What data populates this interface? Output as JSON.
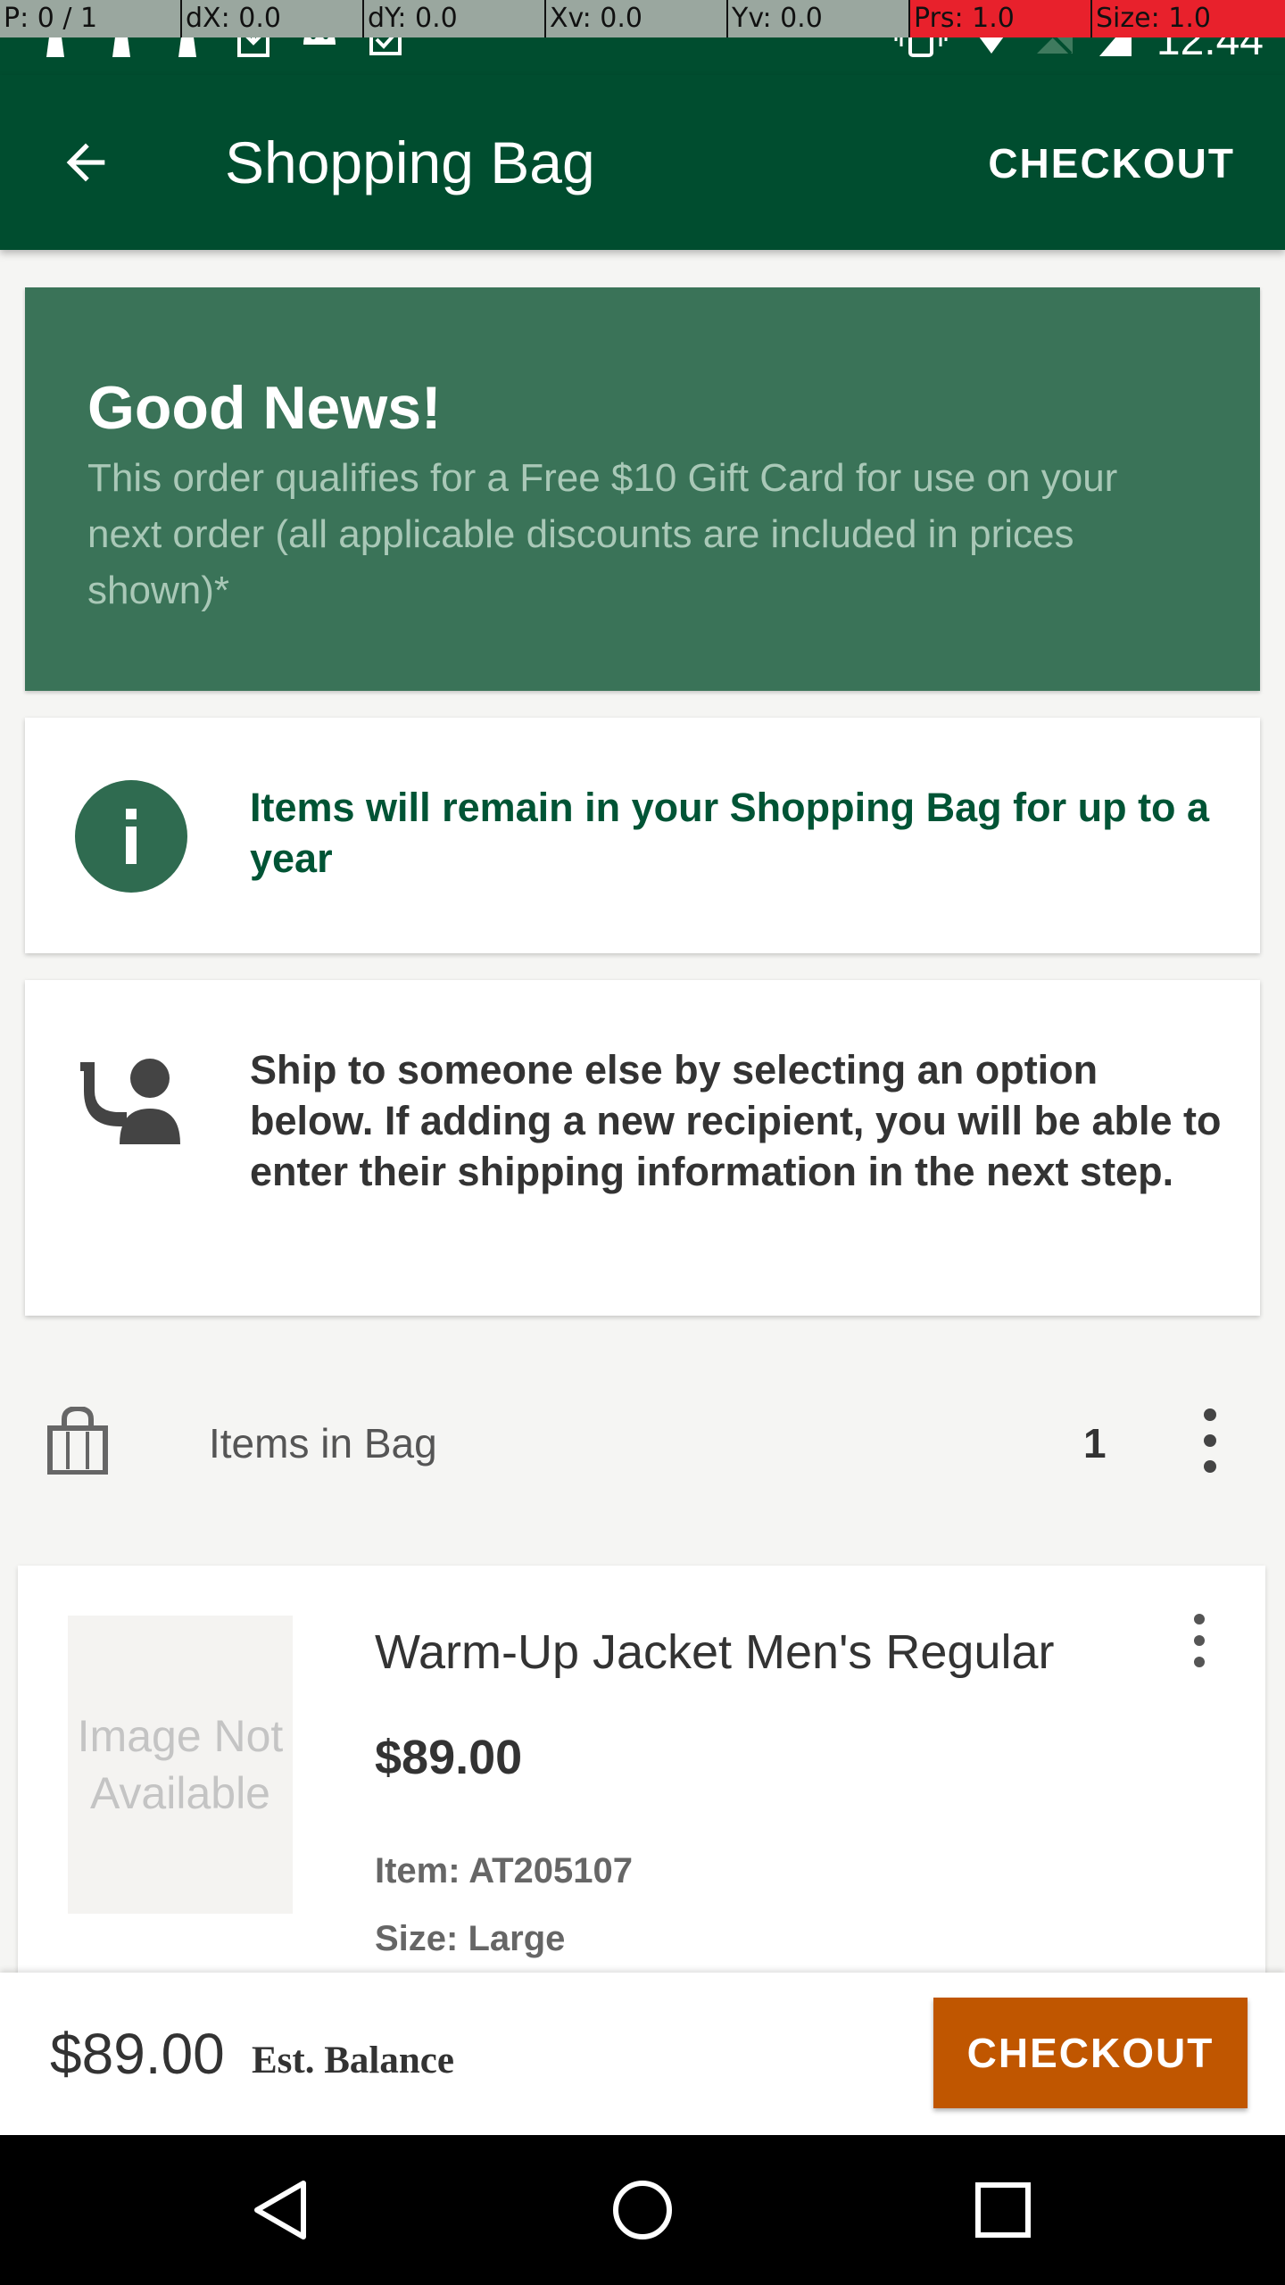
{
  "debug_bar": [
    "P: 0 / 1",
    "dX: 0.0",
    "dY: 0.0",
    "Xv: 0.0",
    "Yv: 0.0",
    "Prs: 1.0",
    "Size: 1.0"
  ],
  "status_bar": {
    "time": "12:44"
  },
  "toolbar": {
    "title": "Shopping Bag",
    "action": "CHECKOUT"
  },
  "promo": {
    "title": "Good News!",
    "body": "This order qualifies for a Free $10 Gift Card for use on your next order (all applicable discounts are included in prices shown)*"
  },
  "info": {
    "text": "Items will remain in your Shopping Bag for up to a year"
  },
  "ship": {
    "text": "Ship to someone else by selecting an option below. If adding a new recipient, you will be able to enter their shipping information in the next step."
  },
  "bag": {
    "label": "Items in Bag",
    "count": "1"
  },
  "product": {
    "image_placeholder": "Image Not Available",
    "name": "Warm-Up Jacket Men's Regular",
    "price": "$89.00",
    "item": "Item: AT205107",
    "size": "Size: Large"
  },
  "checkout_bar": {
    "total": "$89.00",
    "label": "Est. Balance",
    "button": "CHECKOUT"
  },
  "colors": {
    "primary": "#004d2f",
    "promo": "#3a7358",
    "accent": "#c05600"
  }
}
